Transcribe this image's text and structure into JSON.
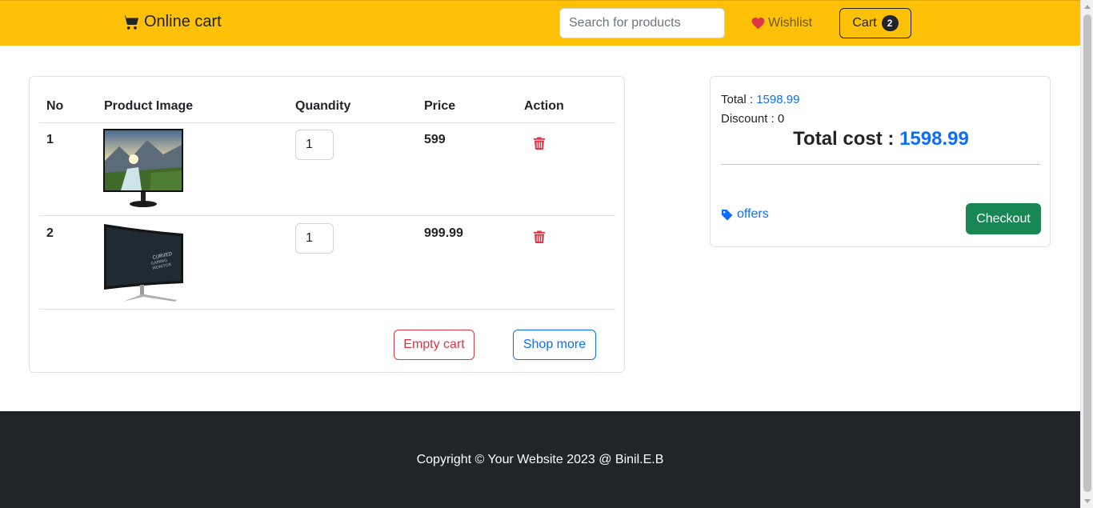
{
  "navbar": {
    "brand": "Online cart",
    "brand_icon": "cart-icon",
    "search_placeholder": "Search for products",
    "wishlist_label": "Wishlist",
    "wishlist_icon": "heart-icon",
    "cart_label": "Cart",
    "cart_count": "2"
  },
  "cart": {
    "headers": {
      "no": "No",
      "image": "Product Image",
      "quantity": "Quandity",
      "price": "Price",
      "action": "Action"
    },
    "items": [
      {
        "no": "1",
        "image": "monitor-landscape-image",
        "quantity": "1",
        "price": "599",
        "action_icon": "trash-icon"
      },
      {
        "no": "2",
        "image": "curved-monitor-image",
        "quantity": "1",
        "price": "999.99",
        "action_icon": "trash-icon"
      }
    ],
    "empty_label": "Empty cart",
    "shop_more_label": "Shop more"
  },
  "summary": {
    "total_label": "Total :",
    "total_value": "1598.99",
    "discount_label": "Discount :",
    "discount_value": "0",
    "total_cost_label": "Total cost :",
    "total_cost_value": "1598.99",
    "offers_label": "offers",
    "offers_icon": "tag-icon",
    "checkout_label": "Checkout"
  },
  "footer": {
    "text": "Copyright © Your Website 2023 @ Binil.E.B"
  },
  "colors": {
    "navbar": "#ffc107",
    "primary": "#0d6efd",
    "danger": "#dc3545",
    "success": "#198754",
    "footer": "#212529"
  }
}
